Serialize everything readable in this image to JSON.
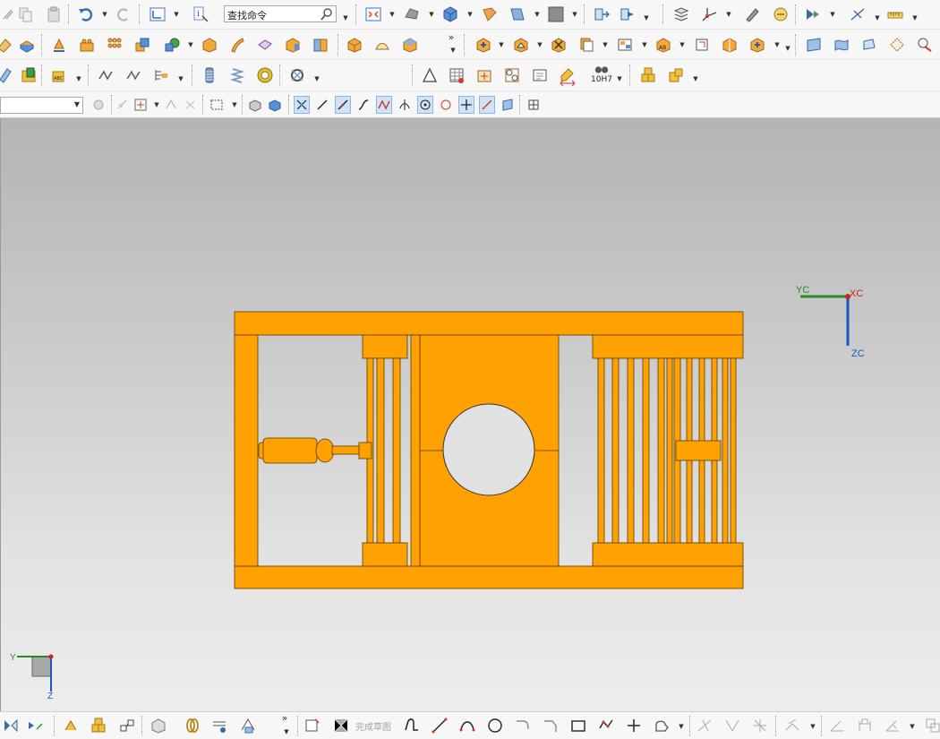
{
  "toolbar": {
    "search_placeholder": "查找命令",
    "more_glyph": "»",
    "fit_tolerance_label": "10H7"
  },
  "selection_filter": {
    "selected_value": ""
  },
  "viewport": {
    "wcs_labels": {
      "xc": "XC",
      "yc": "YC",
      "zc": "ZC"
    },
    "absolute_csys_labels": {
      "y": "Y",
      "z": "Z"
    },
    "colors": {
      "part_body": "#FFA100",
      "xc_axis": "#cc2222",
      "yc_axis": "#2a8a2a",
      "zc_axis": "#1a55c8",
      "background_top": "#b4b4b4",
      "background_bottom": "#ededed"
    }
  },
  "sketch_toolbar": {
    "finish_sketch_label": "完成草图"
  },
  "icons": [
    "cut-icon",
    "copy-icon",
    "paste-icon",
    "undo-icon",
    "redo-icon",
    "wcs-icon",
    "info-icon",
    "fit-view-icon",
    "shaded-icon",
    "view-orient-icon",
    "layer-icon",
    "clip-icon",
    "background-icon",
    "extrude-icon",
    "revolve-icon",
    "block-icon",
    "hole-icon",
    "pattern-icon",
    "mold-icon",
    "bolt-icon",
    "spring-icon",
    "bearing-icon",
    "triangle-icon",
    "table-icon",
    "note-icon",
    "measure-icon",
    "sketch-icon",
    "line-icon",
    "arc-icon",
    "circle-icon",
    "rectangle-icon",
    "point-icon",
    "polygon-icon",
    "trim-icon",
    "extend-icon",
    "mirror-icon"
  ]
}
